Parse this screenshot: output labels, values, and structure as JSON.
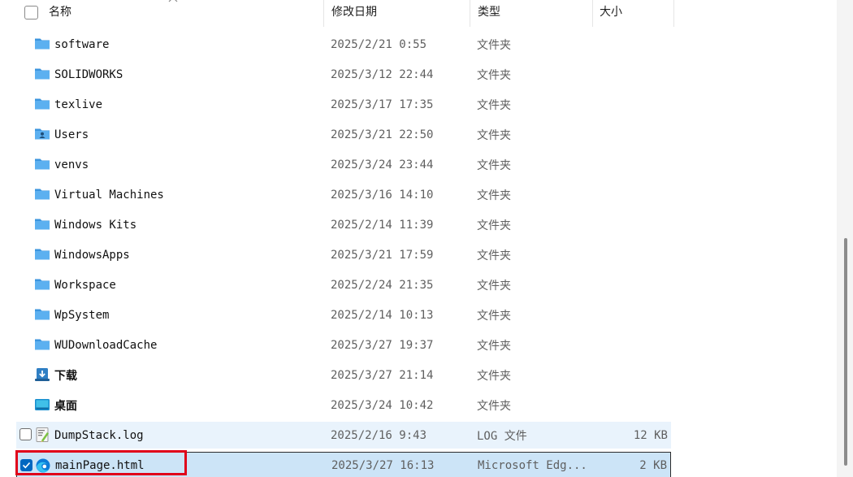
{
  "columns": {
    "name": "名称",
    "modified": "修改日期",
    "type": "类型",
    "size": "大小"
  },
  "rows": [
    {
      "name": "software",
      "date": "2025/2/21 0:55",
      "type": "文件夹",
      "size": "",
      "icon": "folder-icon"
    },
    {
      "name": "SOLIDWORKS",
      "date": "2025/3/12 22:44",
      "type": "文件夹",
      "size": "",
      "icon": "folder-icon"
    },
    {
      "name": "texlive",
      "date": "2025/3/17 17:35",
      "type": "文件夹",
      "size": "",
      "icon": "folder-icon"
    },
    {
      "name": "Users",
      "date": "2025/3/21 22:50",
      "type": "文件夹",
      "size": "",
      "icon": "users-folder-icon"
    },
    {
      "name": "venvs",
      "date": "2025/3/24 23:44",
      "type": "文件夹",
      "size": "",
      "icon": "folder-icon"
    },
    {
      "name": "Virtual Machines",
      "date": "2025/3/16 14:10",
      "type": "文件夹",
      "size": "",
      "icon": "folder-icon"
    },
    {
      "name": "Windows Kits",
      "date": "2025/2/14 11:39",
      "type": "文件夹",
      "size": "",
      "icon": "folder-icon"
    },
    {
      "name": "WindowsApps",
      "date": "2025/3/21 17:59",
      "type": "文件夹",
      "size": "",
      "icon": "folder-icon"
    },
    {
      "name": "Workspace",
      "date": "2025/2/24 21:35",
      "type": "文件夹",
      "size": "",
      "icon": "folder-icon"
    },
    {
      "name": "WpSystem",
      "date": "2025/2/14 10:13",
      "type": "文件夹",
      "size": "",
      "icon": "folder-icon"
    },
    {
      "name": "WUDownloadCache",
      "date": "2025/3/27 19:37",
      "type": "文件夹",
      "size": "",
      "icon": "folder-icon"
    },
    {
      "name": "下载",
      "date": "2025/3/27 21:14",
      "type": "文件夹",
      "size": "",
      "icon": "downloads-folder-icon"
    },
    {
      "name": "桌面",
      "date": "2025/3/24 10:42",
      "type": "文件夹",
      "size": "",
      "icon": "desktop-folder-icon"
    },
    {
      "name": "DumpStack.log",
      "date": "2025/2/16 9:43",
      "type": "LOG 文件",
      "size": "12 KB",
      "icon": "log-file-icon"
    },
    {
      "name": "mainPage.html",
      "date": "2025/3/27 16:13",
      "type": "Microsoft Edg...",
      "size": "2 KB",
      "icon": "edge-html-file-icon"
    }
  ],
  "colors": {
    "folder": "#5cb0f0",
    "selection": "#cce4f7",
    "hover": "#e9f3fc",
    "checkbox_checked": "#0067c0",
    "annotation_box": "#e0001a"
  }
}
